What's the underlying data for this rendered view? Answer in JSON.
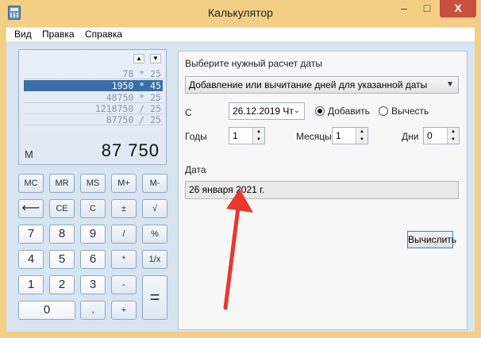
{
  "window": {
    "title": "Калькулятор",
    "buttons": {
      "minimize": "–",
      "maximize": "□",
      "close": "X"
    }
  },
  "menu": [
    "Вид",
    "Правка",
    "Справка"
  ],
  "display": {
    "history": [
      "78 * 25",
      "1950 * 45",
      "48750 * 25",
      "1218750 / 25",
      "87750 / 25"
    ],
    "selected_history_index": 1,
    "memory_indicator": "M",
    "value": "87 750",
    "scroll_up": "▲",
    "scroll_down": "▼"
  },
  "keys": {
    "mc": "MC",
    "mr": "MR",
    "ms": "MS",
    "mplus": "M+",
    "mminus": "M-",
    "back": "⟵",
    "ce": "CE",
    "c": "C",
    "sign": "±",
    "sqrt": "√",
    "k7": "7",
    "k8": "8",
    "k9": "9",
    "div": "/",
    "pct": "%",
    "k4": "4",
    "k5": "5",
    "k6": "6",
    "mul": "*",
    "recip": "1/x",
    "k1": "1",
    "k2": "2",
    "k3": "3",
    "sub": "-",
    "eq": "=",
    "k0": "0",
    "dec": ",",
    "add": "+"
  },
  "date_panel": {
    "heading": "Выберите нужный расчет даты",
    "mode": "Добавление или вычитание дней для указанной даты",
    "from_label": "С",
    "from_date": "26.12.2019 Чт",
    "radio_add": "Добавить",
    "radio_subtract": "Вычесть",
    "radio_add_selected": true,
    "years_label": "Годы",
    "years_value": "1",
    "months_label": "Месяцы",
    "months_value": "1",
    "days_label": "Дни",
    "days_value": "0",
    "result_label": "Дата",
    "result_value": "26 января 2021 г.",
    "calculate_button": "Вычислить"
  },
  "colors": {
    "annotation_arrow": "#e8382e",
    "selection": "#3a6ea5",
    "window_frame": "#f3cf86"
  }
}
